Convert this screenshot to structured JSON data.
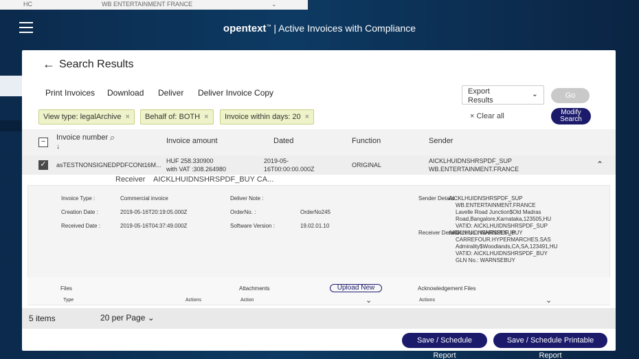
{
  "background": {
    "ghost_left": "HC",
    "ghost_center": "WB ENTERTAINMENT FRANCE"
  },
  "header": {
    "brand": "opentext",
    "brand_tm": "™",
    "divider": "|",
    "product": "Active Invoices with Compliance"
  },
  "page": {
    "title": "Search Results"
  },
  "actions": {
    "print": "Print Invoices",
    "download": "Download",
    "deliver": "Deliver",
    "deliver_copy": "Deliver Invoice Copy",
    "export_line1": "Export",
    "export_line2": "Results",
    "go": "Go"
  },
  "filters": {
    "chips": [
      {
        "label": "View type: legalArchive",
        "close": "×"
      },
      {
        "label": "Behalf of: BOTH",
        "close": "×"
      },
      {
        "label": "Invoice within days: 20",
        "close": "×"
      }
    ],
    "clear_all": "× Clear all",
    "modify_line1": "Modify",
    "modify_line2": "Search"
  },
  "table": {
    "columns": {
      "invoice_number": "Invoice number",
      "invoice_amount": "Invoice amount",
      "dated": "Dated",
      "function": "Function",
      "sender": "Sender"
    },
    "rows": [
      {
        "invoice_number": "asTESTNONSIGNEDPDFCONt16M...",
        "amount_line1": "HUF 258.330900",
        "amount_line2": "with VAT :308.264980",
        "dated_line1": "2019-05-",
        "dated_line2": "16T00:00:00.000Z",
        "function": "ORIGINAL",
        "sender_line1": "AICKLHUIDNSHRSPDF_SUP",
        "sender_line2": "WB.ENTERTAINMENT.FRANCE"
      }
    ],
    "receiver_label": "Receiver",
    "receiver_value": "AICKLHUIDNSHRSPDF_BUY CA..."
  },
  "details": {
    "invoice_type_label": "Invoice Type :",
    "invoice_type_value": "Commercial invoice",
    "creation_date_label": "Creation Date :",
    "creation_date_value": "2019-05-16T20:19:05.000Z",
    "received_date_label": "Received Date :",
    "received_date_value": "2019-05-16T04:37:49.000Z",
    "deliver_note_label": "Deliver Note :",
    "order_no_label": "OrderNo. :",
    "order_no_value": "OrderNo245",
    "software_version_label": "Software Version :",
    "software_version_value": "19.02.01.10",
    "sender_details_label": "Sender Details :",
    "sender_details": [
      "AICKLHUIDNSHRSPDF_SUP",
      "WB.ENTERTAINMENT.FRANCE",
      "Lavelle Road Junction$Old Madras Road,Bangalore,Karnataka,123505,HU",
      "VATID: AICKLHUIDNSHRSPDF_SUP",
      "GLN No.: WARNSESUP"
    ],
    "receiver_details_label": "Receiver Details :",
    "receiver_details": [
      "AICKLHUIDNSHRSPDF_BUY",
      "CARREFOUR.HYPERMARCHES.SAS",
      "Admirality$Woodlands,CA,SA,123491,HU",
      "VATID: AICKLHUIDNSHRSPDF_BUY",
      "GLN No.: WARNSEBUY"
    ]
  },
  "files": {
    "files_label": "Files",
    "attachments_label": "Attachments",
    "upload_new": "Upload New",
    "ack_label": "Acknowledgement Files",
    "type_col": "Type",
    "actions_col": "Actions",
    "attach_action_col": "Action",
    "ack_actions_col": "Actions"
  },
  "footer": {
    "items": "5 items",
    "per_page": "20 per Page"
  },
  "buttons": {
    "save_report": "Save / Schedule Report",
    "save_printable": "Save / Schedule Printable Report"
  }
}
